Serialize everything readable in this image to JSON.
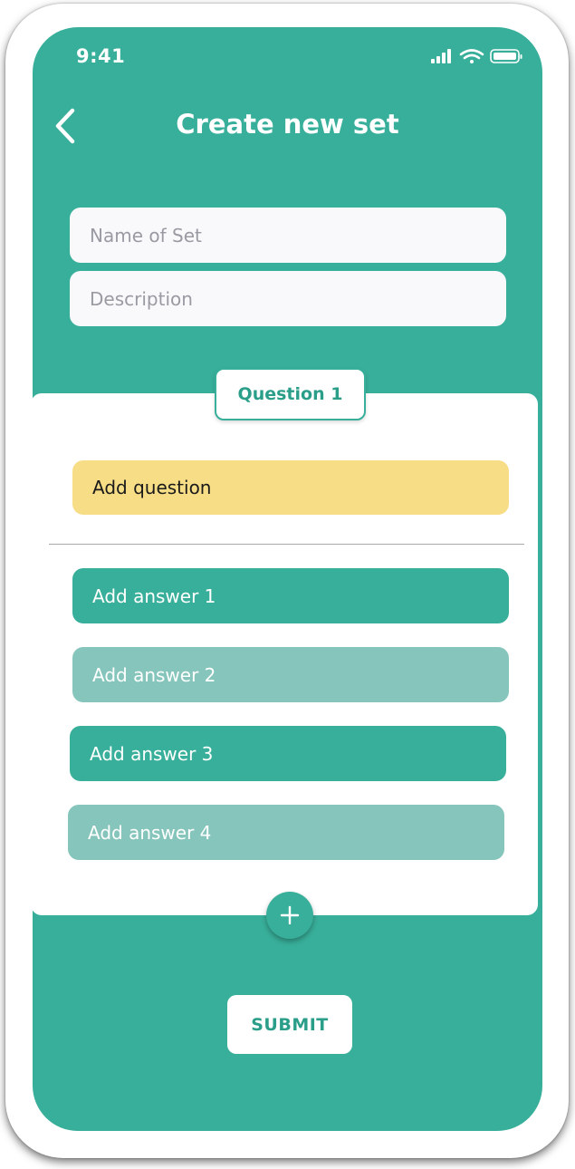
{
  "status_bar": {
    "time": "9:41",
    "icons": [
      "cellular-signal-icon",
      "wifi-icon",
      "battery-icon"
    ]
  },
  "header": {
    "back_icon": "chevron-left-icon",
    "title": "Create new set"
  },
  "form": {
    "name_placeholder": "Name of Set",
    "name_value": "",
    "description_placeholder": "Description",
    "description_value": ""
  },
  "question": {
    "tab_label": "Question 1",
    "question_placeholder": "Add question",
    "answers": [
      "Add answer 1",
      "Add answer 2",
      "Add answer 3",
      "Add answer 4"
    ]
  },
  "add_button_icon": "plus-icon",
  "submit_label": "SUBMIT",
  "colors": {
    "primary": "#38af9a",
    "primary_light": "#86c5bb",
    "question_highlight": "#f7dd86",
    "surface": "#ffffff",
    "input_background": "#f9f9fb"
  }
}
